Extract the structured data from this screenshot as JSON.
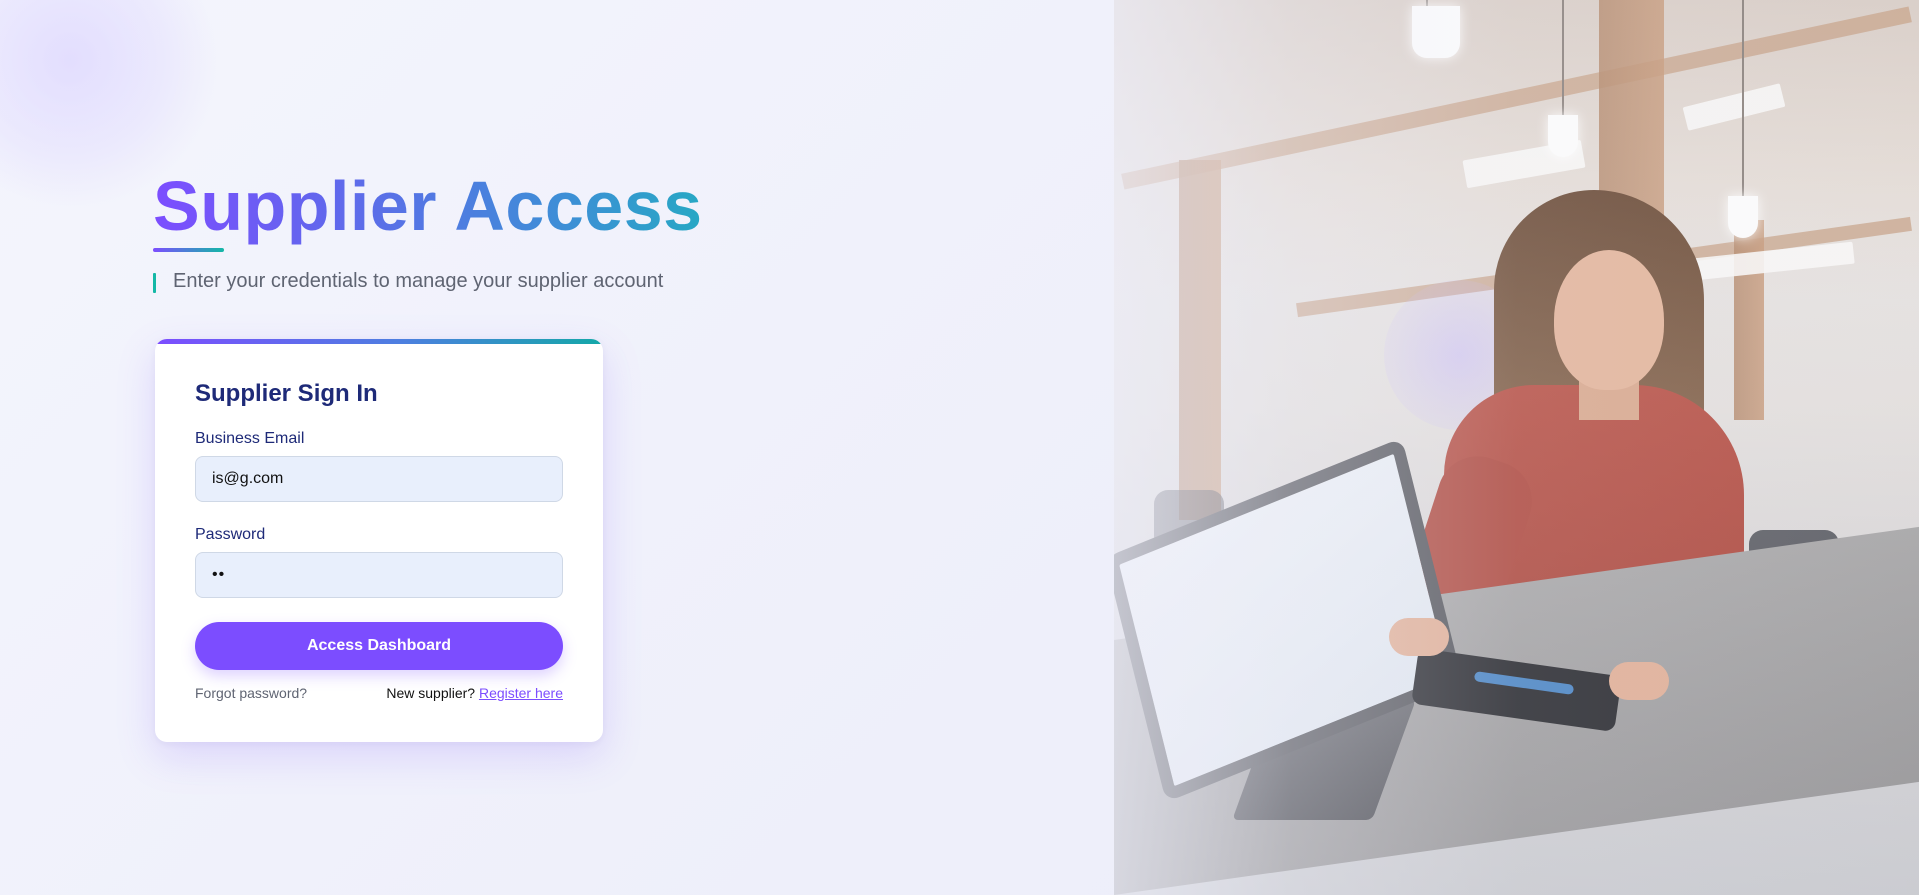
{
  "hero": {
    "title": "Supplier Access",
    "subtitle": "Enter your credentials to manage your supplier account"
  },
  "signin": {
    "title": "Supplier Sign In",
    "email_label": "Business Email",
    "email_value": "is@g.com",
    "password_label": "Password",
    "password_value": "••",
    "submit_label": "Access Dashboard",
    "forgot_label": "Forgot password?",
    "new_supplier_text": "New supplier?",
    "register_label": "Register here"
  },
  "image": {
    "alt": "retail-point-of-sale-photo"
  },
  "colors": {
    "accent_purple": "#7c4dff",
    "accent_teal": "#14b8a6",
    "heading_navy": "#1e2a78",
    "input_bg": "#e8effc"
  }
}
